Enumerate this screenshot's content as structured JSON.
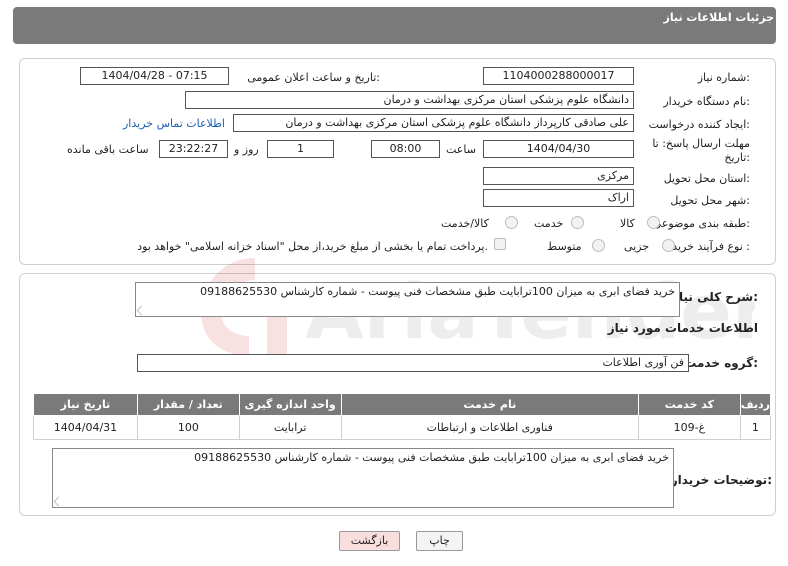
{
  "header": {
    "title": "جزئیات اطلاعات نیاز"
  },
  "fields": {
    "need_number_label": "شماره نیاز:",
    "need_number": "1104000288000017",
    "announce_label": "تاریخ و ساعت اعلان عمومی:",
    "announce_value": "1404/04/28 - 07:15",
    "buyer_org_label": "نام دستگاه خریدار:",
    "buyer_org": "دانشگاه علوم پزشکی  استان مرکزی   بهداشت و درمان",
    "requester_label": "ایجاد کننده درخواست:",
    "requester": "علی صادقی کارپرداز دانشگاه علوم پزشکی  استان مرکزی   بهداشت و درمان",
    "contact_link": "اطلاعات تماس خریدار",
    "deadline_label_line1": "مهلت ارسال پاسخ: تا",
    "deadline_label_line2": "تاریخ:",
    "deadline_date": "1404/04/30",
    "time_label": "ساعت",
    "deadline_time": "08:00",
    "days_value": "1",
    "days_label": "روز و",
    "remaining_time": "23:22:27",
    "remaining_label": "ساعت باقی مانده",
    "province_label": "استان محل تحویل:",
    "province": "مرکزی",
    "city_label": "شهر محل تحویل:",
    "city": "اراک",
    "category_label": "طبقه بندی موضوعی:",
    "category_options": [
      "کالا",
      "خدمت",
      "کالا/خدمت"
    ],
    "process_label": "نوع فرآیند خرید :",
    "process_options": [
      "جزیی",
      "متوسط"
    ],
    "payment_note": "پرداخت تمام یا بخشی از مبلغ خرید،از محل \"اسناد خزانه اسلامی\" خواهد بود."
  },
  "general_desc": {
    "label": "شرح کلی نیاز:",
    "text": "خرید فضای ابری به میزان 100ترابایت طبق مشخصات فنی پیوست - شماره کارشناس 09188625530"
  },
  "services": {
    "section_title": "اطلاعات خدمات مورد نیاز",
    "group_label": "گروه خدمت:",
    "group_value": "فن آوری اطلاعات",
    "columns": [
      "ردیف",
      "کد خدمت",
      "نام خدمت",
      "واحد اندازه گیری",
      "تعداد / مقدار",
      "تاریخ نیاز"
    ],
    "rows": [
      {
        "row": "1",
        "code": "غ-109",
        "name": "فناوری اطلاعات و ارتباطات",
        "unit": "ترابایت",
        "qty": "100",
        "date": "1404/04/31"
      }
    ]
  },
  "buyer_notes": {
    "label": "توضیحات خریدار:",
    "text": "خرید فضای ابری به میزان 100ترابایت طبق مشخصات فنی پیوست - شماره کارشناس 09188625530"
  },
  "buttons": {
    "print": "چاپ",
    "back": "بازگشت"
  },
  "watermark": {
    "text": "AriaTender.neT"
  },
  "colors": {
    "header": "#7a7a7a",
    "link": "#1a5fb4",
    "back_button": "#f9dede"
  }
}
